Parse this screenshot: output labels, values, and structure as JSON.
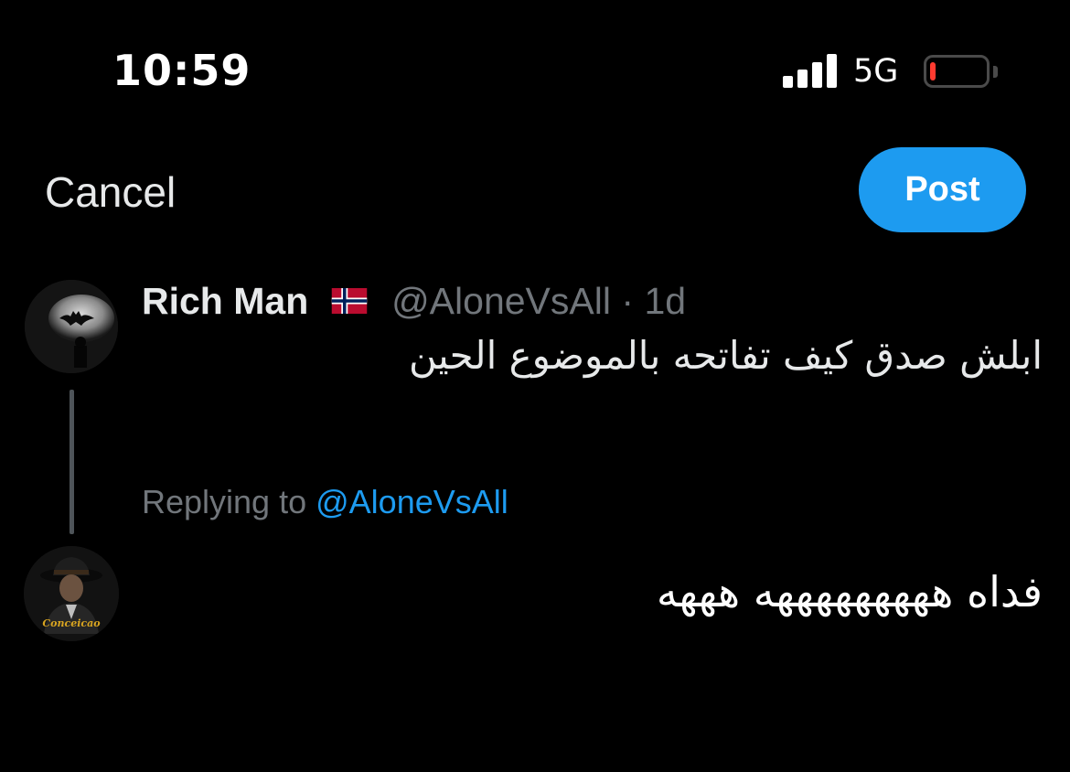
{
  "status_bar": {
    "time": "10:59",
    "network": "5G",
    "battery_level": 0.1,
    "battery_color": "#ff3b30"
  },
  "header": {
    "cancel_label": "Cancel",
    "post_label": "Post",
    "accent": "#1d9bf0"
  },
  "original_tweet": {
    "author_name": "Rich Man",
    "flag_icon": "norway-flag-icon",
    "handle": "@AloneVsAll",
    "separator": "·",
    "age": "1d",
    "text": "ابلش صدق كيف تفاتحه بالموضوع الحين",
    "avatar_icon": "batman-signal-avatar"
  },
  "reply": {
    "replying_prefix": "Replying to",
    "replying_handle": "@AloneVsAll",
    "text": "فداه هههههههههه هههه",
    "avatar_icon": "fedora-man-avatar",
    "avatar_caption": "Conceicao"
  }
}
